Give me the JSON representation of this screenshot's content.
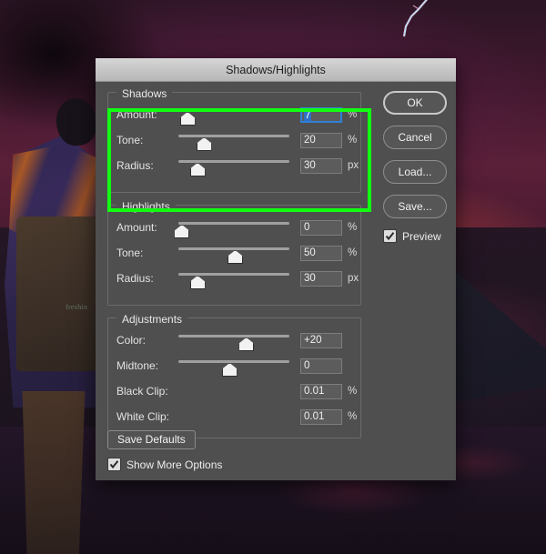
{
  "window": {
    "title": "Shadows/Highlights"
  },
  "annotation": {
    "highlight_color": "#12ff12",
    "target_group": "Shadows"
  },
  "groups": [
    {
      "legend": "Shadows",
      "rows": [
        {
          "label": "Amount:",
          "value": "7",
          "unit": "%",
          "slider_pct": 7,
          "focused": true,
          "selected": true
        },
        {
          "label": "Tone:",
          "value": "20",
          "unit": "%",
          "slider_pct": 22,
          "focused": false,
          "selected": false
        },
        {
          "label": "Radius:",
          "value": "30",
          "unit": "px",
          "slider_pct": 16,
          "focused": false,
          "selected": false
        }
      ]
    },
    {
      "legend": "Highlights",
      "rows": [
        {
          "label": "Amount:",
          "value": "0",
          "unit": "%",
          "slider_pct": 2,
          "focused": false,
          "selected": false
        },
        {
          "label": "Tone:",
          "value": "50",
          "unit": "%",
          "slider_pct": 50,
          "focused": false,
          "selected": false
        },
        {
          "label": "Radius:",
          "value": "30",
          "unit": "px",
          "slider_pct": 16,
          "focused": false,
          "selected": false
        }
      ]
    },
    {
      "legend": "Adjustments",
      "rows": [
        {
          "label": "Color:",
          "value": "+20",
          "unit": "",
          "slider_pct": 60,
          "focused": false,
          "selected": false
        },
        {
          "label": "Midtone:",
          "value": "0",
          "unit": "",
          "slider_pct": 45,
          "focused": false,
          "selected": false
        },
        {
          "label": "Black Clip:",
          "value": "0.01",
          "unit": "%",
          "slider_pct": null,
          "focused": false,
          "selected": false
        },
        {
          "label": "White Clip:",
          "value": "0.01",
          "unit": "%",
          "slider_pct": null,
          "focused": false,
          "selected": false
        }
      ]
    }
  ],
  "buttons": {
    "ok": "OK",
    "cancel": "Cancel",
    "load": "Load...",
    "save": "Save...",
    "save_defaults": "Save Defaults"
  },
  "checkboxes": {
    "preview": {
      "label": "Preview",
      "checked": true
    },
    "show_more_options": {
      "label": "Show More Options",
      "checked": true
    }
  }
}
